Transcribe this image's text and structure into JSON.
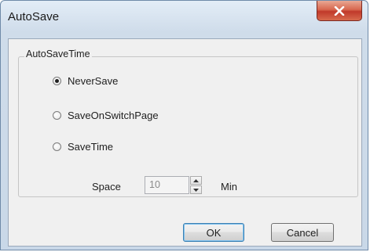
{
  "window": {
    "title": "AutoSave"
  },
  "group": {
    "label": "AutoSaveTime"
  },
  "options": [
    {
      "label": "NeverSave",
      "checked": true
    },
    {
      "label": "SaveOnSwitchPage",
      "checked": false
    },
    {
      "label": "SaveTime",
      "checked": false
    }
  ],
  "space": {
    "label": "Space",
    "value": "10",
    "unit": "Min"
  },
  "buttons": {
    "ok": "OK",
    "cancel": "Cancel"
  },
  "colors": {
    "close_button": "#c0392b",
    "frame": "#c9d8e8",
    "client": "#f0f0f0"
  }
}
